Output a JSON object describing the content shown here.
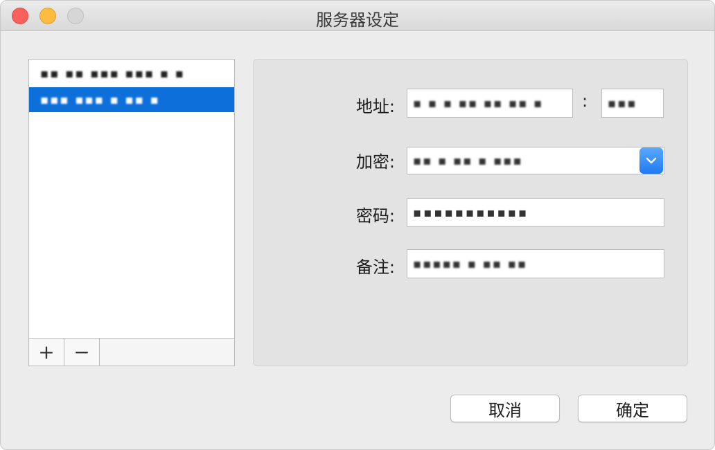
{
  "window": {
    "title": "服务器设定"
  },
  "server_list": {
    "items": [
      {
        "label": "▪▪ ▪▪ ▪▪▪ ▪▪▪ ▪ ▪",
        "selected": false
      },
      {
        "label": "▪▪▪ ▪▪▪ ▪ ▪▪ ▪",
        "selected": true
      }
    ],
    "add_label": "+",
    "remove_label": "−"
  },
  "form": {
    "address_label": "地址:",
    "address_value": "▪ ▪ ▪ ▪▪ ▪▪ ▪▪ ▪",
    "port_separator": ":",
    "port_value": "▪▪▪",
    "encryption_label": "加密:",
    "encryption_value": "▪▪ ▪ ▪▪ ▪ ▪▪▪",
    "password_label": "密码:",
    "password_value": "▪▪▪▪▪▪▪▪▪▪▪",
    "note_label": "备注:",
    "note_value": "▪▪▪▪▪ ▪ ▪▪ ▪▪"
  },
  "buttons": {
    "cancel_label": "取消",
    "ok_label": "确定"
  },
  "colors": {
    "selection": "#0d6fd9",
    "select_button": "#1f7bf2",
    "close": "#fc605c",
    "minimize": "#fdbc40",
    "zoom": "#d6d6d6"
  }
}
